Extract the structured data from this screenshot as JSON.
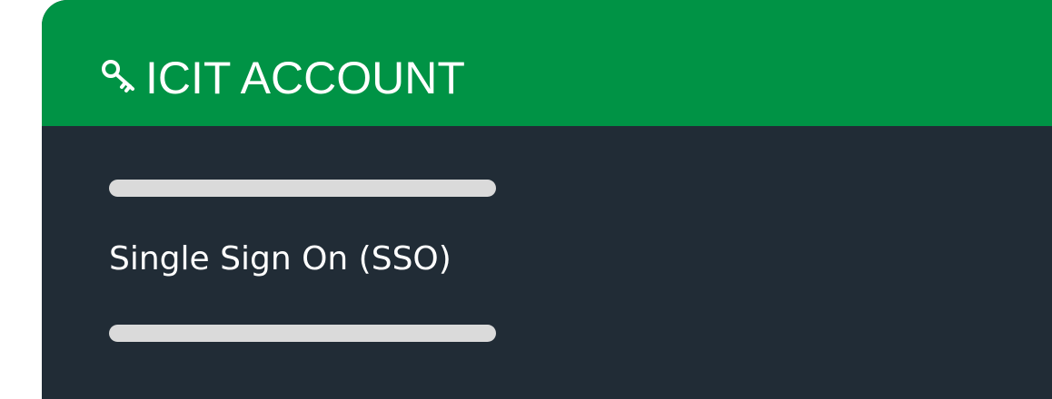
{
  "header": {
    "title": "ICIT ACCOUNT",
    "icon": "key-icon",
    "background_color": "#009345"
  },
  "body": {
    "background_color": "#212c36",
    "sso_link_label": "Single Sign On (SSO)"
  }
}
